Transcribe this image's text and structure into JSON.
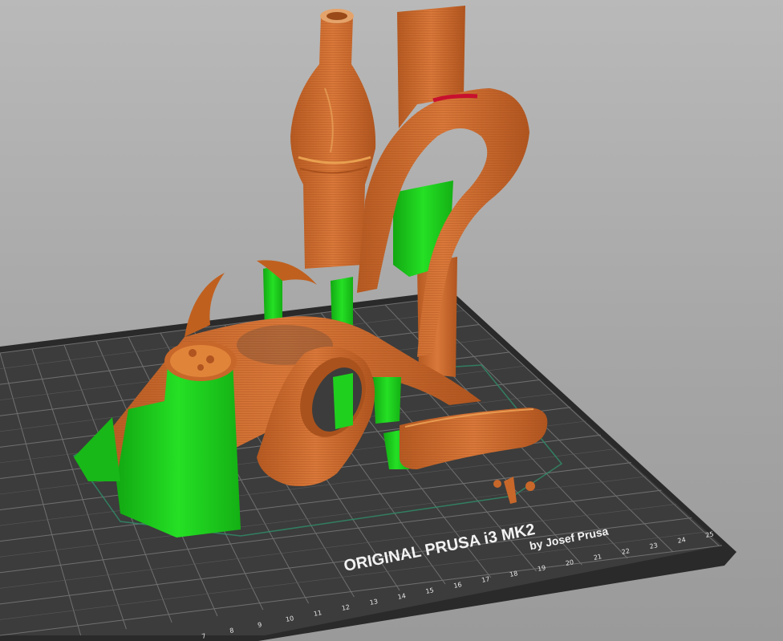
{
  "bed": {
    "brand_line1": "ORIGINAL PRUSA i3  MK2",
    "brand_line2": "by Josef Prusa",
    "x_ticks": [
      "7",
      "8",
      "9",
      "10",
      "11",
      "12",
      "13",
      "14",
      "15",
      "16",
      "17",
      "18",
      "19",
      "20",
      "21",
      "22",
      "23",
      "24",
      "25"
    ]
  },
  "colors": {
    "background": "#a8a8a8",
    "bed_surface": "#3c3c3c",
    "bed_frame": "#2a2a2a",
    "grid_line": "#7a7a7a",
    "model_orange": "#c8672a",
    "model_orange_light": "#e0843a",
    "support_green": "#1fd01f",
    "skirt_line": "#2f8f6a"
  },
  "objects": [
    {
      "name": "bottle",
      "icon": "bottle-model"
    },
    {
      "name": "tall-block",
      "icon": "block-model"
    },
    {
      "name": "arch-handle",
      "icon": "arch-model"
    },
    {
      "name": "crescent-sculpture",
      "icon": "crescent-model"
    },
    {
      "name": "ring-cone",
      "icon": "ring-model"
    },
    {
      "name": "bar-piece",
      "icon": "bar-model"
    },
    {
      "name": "small-pins",
      "icon": "pin-model"
    }
  ]
}
